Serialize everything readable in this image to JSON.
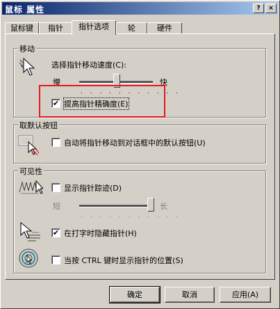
{
  "window": {
    "title": "鼠标 属性",
    "help_button": "?",
    "close_button": "×"
  },
  "tabs": [
    "鼠标键",
    "指针",
    "指针选项",
    "轮",
    "硬件"
  ],
  "motion": {
    "group_label": "移动",
    "speed_label": "选择指针移动速度(C):",
    "slow": "慢",
    "fast": "快",
    "speed_value_percent": 55,
    "precision_label": "提高指针精确度(E)",
    "precision_checked": true
  },
  "snap_to": {
    "group_label": "取默认按钮",
    "label": "自动将指针移动到对话框中的默认按钮(U)",
    "checked": false
  },
  "visibility": {
    "group_label": "可见性",
    "trails_label": "显示指针踪迹(D)",
    "trails_checked": false,
    "short": "短",
    "long": "长",
    "trails_value_percent": 100,
    "hide_label": "在打字时隐藏指针(H)",
    "hide_checked": true,
    "ctrl_label": "当按 CTRL 键时显示指针的位置(S)",
    "ctrl_checked": false
  },
  "buttons": {
    "ok": "确定",
    "cancel": "取消",
    "apply": "应用(A)"
  },
  "colors": {
    "highlight_box": "#e8171b",
    "titlebar_start": "#0a246a",
    "titlebar_end": "#a6caf0"
  },
  "icons": [
    "pointer-speed-icon",
    "snap-to-icon",
    "pointer-trails-icon",
    "hide-pointer-icon",
    "ctrl-locate-icon"
  ]
}
